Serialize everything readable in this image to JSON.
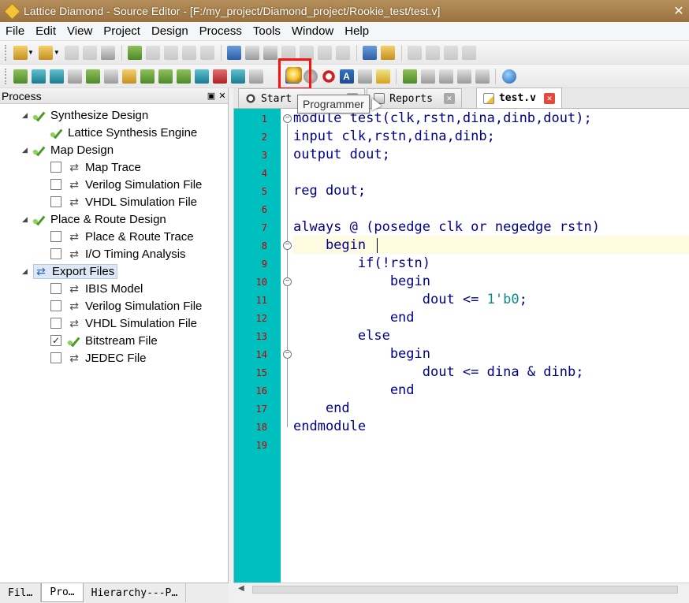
{
  "window": {
    "title": "Lattice Diamond - Source Editor - [F:/my_project/Diamond_project/Rookie_test/test.v]",
    "close_glyph": "✕"
  },
  "menu": [
    "File",
    "Edit",
    "View",
    "Project",
    "Design",
    "Process",
    "Tools",
    "Window",
    "Help"
  ],
  "toolbar": {
    "highlighted_button_icon": "programmer-icon",
    "highlight_color": "#ff1010",
    "tooltip": "Programmer"
  },
  "process_panel": {
    "title": "Process",
    "items": [
      {
        "label": "Synthesize Design",
        "icon": "check-icon",
        "level": 0,
        "checkbox": null
      },
      {
        "label": "Lattice Synthesis Engine",
        "icon": "check-icon",
        "level": 1,
        "checkbox": null
      },
      {
        "label": "Map Design",
        "icon": "check-icon",
        "level": 0,
        "checkbox": null
      },
      {
        "label": "Map Trace",
        "icon": "refresh-icon",
        "level": 1,
        "checkbox": false
      },
      {
        "label": "Verilog Simulation File",
        "icon": "refresh-icon",
        "level": 1,
        "checkbox": false
      },
      {
        "label": "VHDL Simulation File",
        "icon": "refresh-icon",
        "level": 1,
        "checkbox": false
      },
      {
        "label": "Place & Route Design",
        "icon": "check-icon",
        "level": 0,
        "checkbox": null
      },
      {
        "label": "Place & Route Trace",
        "icon": "refresh-icon",
        "level": 1,
        "checkbox": false
      },
      {
        "label": "I/O Timing Analysis",
        "icon": "refresh-icon",
        "level": 1,
        "checkbox": false
      },
      {
        "label": "Export Files",
        "icon": "refresh-icon",
        "level": 0,
        "checkbox": null
      },
      {
        "label": "IBIS Model",
        "icon": "refresh-icon",
        "level": 1,
        "checkbox": false
      },
      {
        "label": "Verilog Simulation File",
        "icon": "refresh-icon",
        "level": 1,
        "checkbox": false
      },
      {
        "label": "VHDL Simulation File",
        "icon": "refresh-icon",
        "level": 1,
        "checkbox": false
      },
      {
        "label": "Bitstream File",
        "icon": "check-icon",
        "level": 1,
        "checkbox": true
      },
      {
        "label": "JEDEC File",
        "icon": "refresh-icon",
        "level": 1,
        "checkbox": false
      }
    ],
    "bottom_tabs": [
      "Fil…",
      "Pro…",
      "Hierarchy---P…"
    ],
    "active_bottom_tab": 1
  },
  "editor": {
    "tabs": [
      {
        "label": "Start",
        "icon": "start-icon"
      },
      {
        "label": "Reports",
        "icon": "reports-icon"
      },
      {
        "label": "test.v",
        "icon": "file-edit-icon"
      }
    ],
    "active_tab": 2,
    "gutter_color": "#00bfbf",
    "code": [
      "module test(clk,rstn,dina,dinb,dout);",
      "input clk,rstn,dina,dinb;",
      "output dout;",
      "",
      "reg dout;",
      "",
      "always @ (posedge clk or negedge rstn)",
      "    begin",
      "        if(!rstn)",
      "            begin",
      "                dout <= 1'b0;",
      "            end",
      "        else",
      "            begin",
      "                dout <= dina & dinb;",
      "            end",
      "    end",
      "endmodule",
      ""
    ],
    "current_line": 8
  }
}
